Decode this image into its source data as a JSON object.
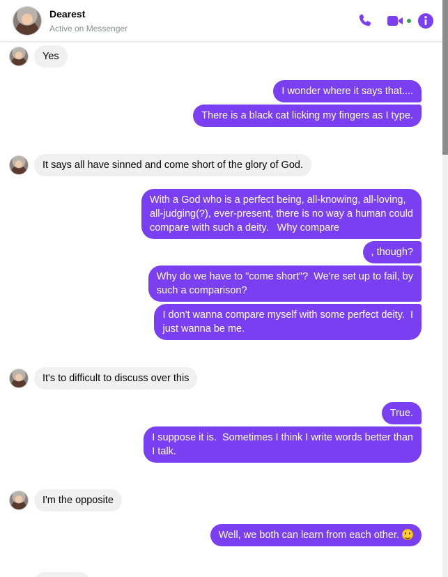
{
  "header": {
    "name": "Dearest",
    "status": "Active on Messenger",
    "icons": [
      "phone-icon",
      "video-camera-icon",
      "info-icon"
    ]
  },
  "colors": {
    "accent": "#7b3ff2",
    "incoming_bubble": "#f0f0f0",
    "online": "#31a24c"
  },
  "messages": [
    {
      "from": "them",
      "text": "Yes"
    },
    {
      "from": "me",
      "text": "I wonder where it says that...."
    },
    {
      "from": "me",
      "text": "There is a black cat licking my fingers as I type."
    },
    {
      "from": "them",
      "text": "It says all have sinned and come short of the glory of God."
    },
    {
      "from": "me",
      "text": "With a God who is a perfect being, all-knowing, all-loving,\nall-judging(?), ever-present, there is no way a human could\ncompare with such a deity.   Why compare"
    },
    {
      "from": "me",
      "text": ", though?"
    },
    {
      "from": "me",
      "text": "Why do we have to \"come short\"?  We're set up to fail, by\nsuch a comparison?"
    },
    {
      "from": "me",
      "text": "I don't wanna compare myself with some perfect deity.  I\njust wanna be me."
    },
    {
      "from": "them",
      "text": "It's to difficult to discuss over this"
    },
    {
      "from": "me",
      "text": "True."
    },
    {
      "from": "me",
      "text": "I suppose it is.  Sometimes I think I write words better than\nI talk."
    },
    {
      "from": "them",
      "text": "I'm the opposite"
    },
    {
      "from": "me",
      "text": "Well, we both can learn from each other.",
      "emoji": "smiley-emoji"
    }
  ]
}
